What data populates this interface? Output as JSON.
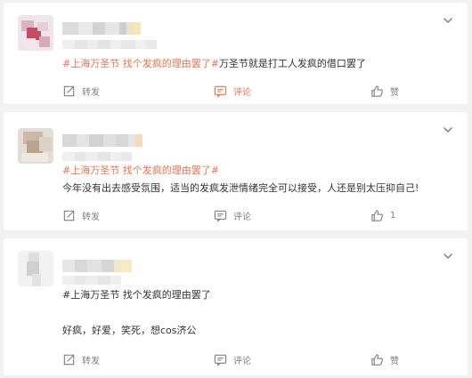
{
  "posts": [
    {
      "content_segments": [
        {
          "text": "#上海万圣节 找个发疯的理由罢了#",
          "type": "topic"
        },
        {
          "text": "万圣节就是打工人发疯的借口罢了",
          "type": "plain"
        }
      ],
      "actions": {
        "repost_label": "转发",
        "comment_label": "评论",
        "like_label": "赞"
      }
    },
    {
      "topic": "#上海万圣节 找个发疯的理由罢了#",
      "body": "今年没有出去感受氛围，适当的发疯发泄情绪完全可以接受，人还是别太压抑自己!",
      "actions": {
        "repost_label": "转发",
        "comment_label": "评论",
        "like_count": "1"
      }
    },
    {
      "topic": "#上海万圣节 找个发疯的理由罢了",
      "body": "好疯，好爱，笑死，想cos济公",
      "actions": {
        "repost_label": "转发",
        "comment_label": "评论",
        "like_label": "赞"
      }
    }
  ],
  "colors": {
    "accent": "#eb7350",
    "text": "#333333",
    "muted": "#808080",
    "background": "#f2f2f2"
  },
  "icons": [
    "chevron-down-icon",
    "repost-icon",
    "comment-icon",
    "like-icon"
  ]
}
